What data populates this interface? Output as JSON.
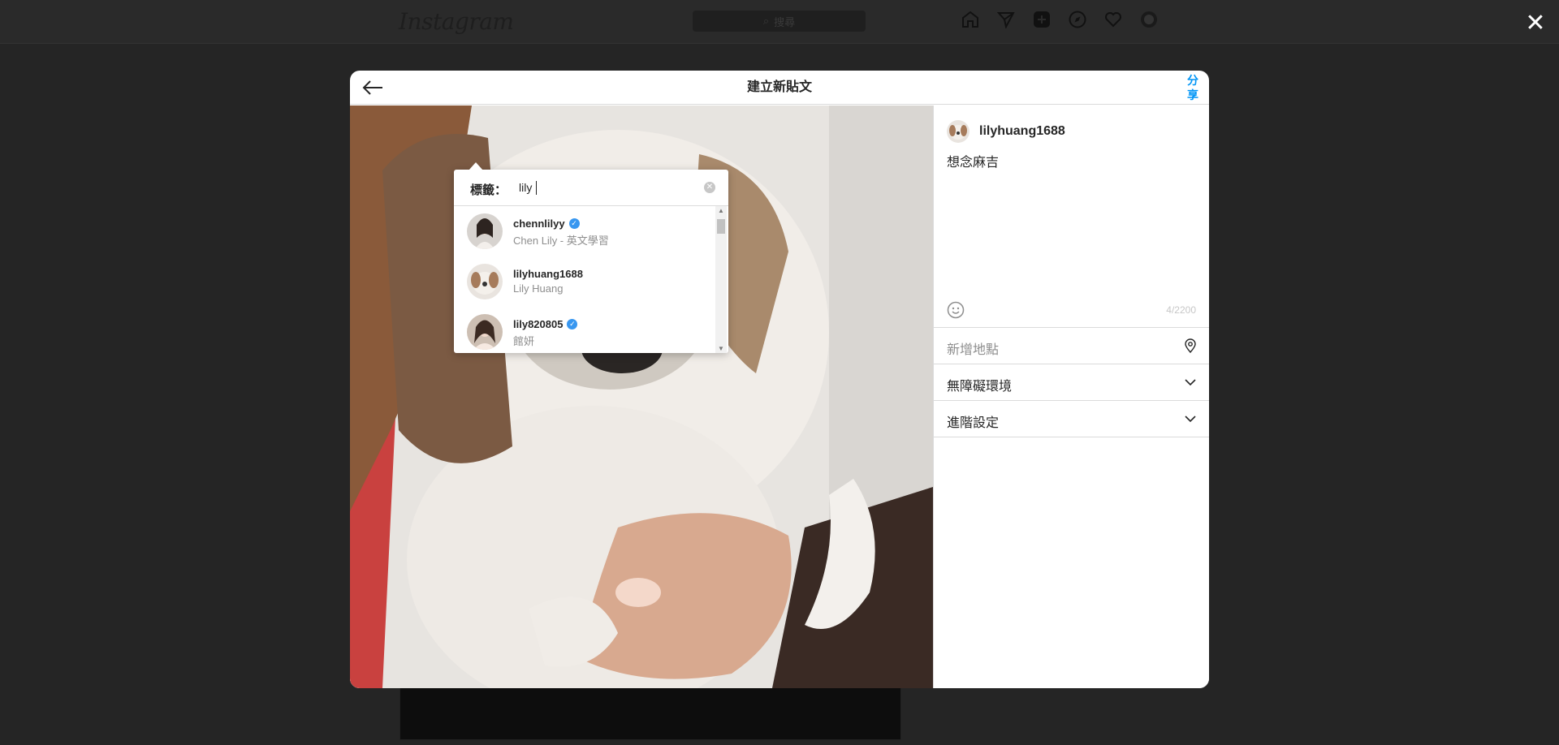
{
  "background": {
    "logo": "Instagram",
    "search_placeholder": "搜尋",
    "nav_icons": [
      "home-icon",
      "direct-icon",
      "new-post-icon",
      "explore-icon",
      "activity-icon",
      "profile-avatar"
    ],
    "close_label": "✕"
  },
  "modal": {
    "title": "建立新貼文",
    "back_icon": "arrow-left-icon",
    "share_label": "分享"
  },
  "tag_popup": {
    "label": "標籤：",
    "query": "lily",
    "clear_icon": "clear-circle-icon",
    "results": [
      {
        "username": "chennlilyy",
        "full_name": "Chen Lily - 英文學習",
        "verified": true
      },
      {
        "username": "lilyhuang1688",
        "full_name": "Lily Huang",
        "verified": false
      },
      {
        "username": "lily820805",
        "full_name": "館妍",
        "verified": true
      }
    ]
  },
  "panel": {
    "username": "lilyhuang1688",
    "caption": "想念麻吉",
    "char_count": "4/2200",
    "location_placeholder": "新增地點",
    "accessibility_label": "無障礙環境",
    "advanced_label": "進階設定"
  },
  "colors": {
    "accent": "#0095f6",
    "verified": "#3897f0",
    "overlay": "#252525"
  }
}
